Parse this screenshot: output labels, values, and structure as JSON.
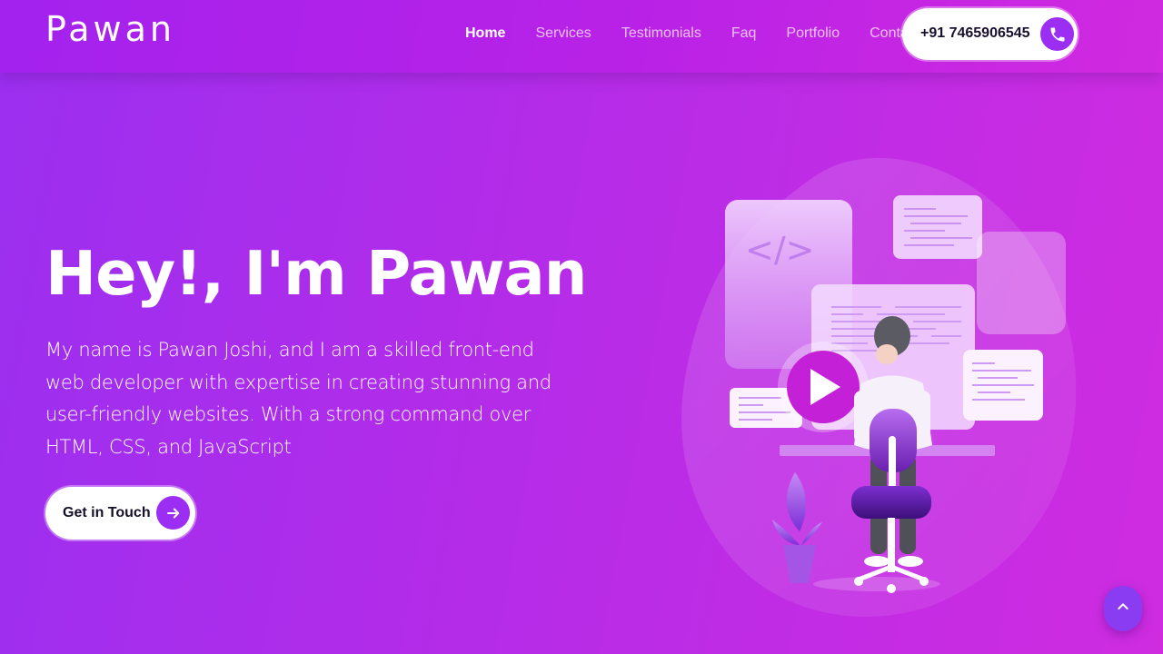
{
  "brand": {
    "logo": "Pawan"
  },
  "nav": {
    "links": [
      {
        "label": "Home",
        "active": true
      },
      {
        "label": "Services"
      },
      {
        "label": "Testimonials"
      },
      {
        "label": "Faq"
      },
      {
        "label": "Portfolio"
      },
      {
        "label": "Contact"
      }
    ],
    "phone": "+91 7465906545",
    "phone_icon": "phone-icon"
  },
  "hero": {
    "title": "Hey!, I'm Pawan",
    "description": "My name is Pawan Joshi, and I am a skilled front-end web developer with expertise in creating stunning and user-friendly websites. With a strong command over HTML, CSS, and JavaScript",
    "cta_label": "Get in Touch",
    "cta_icon": "arrow-right-icon"
  },
  "illustration": {
    "name": "developer-at-desk-illustration",
    "code_symbol": "</>"
  },
  "scroll_top_icon": "chevron-up-icon",
  "colors": {
    "background": "#b42ce8",
    "accent": "#9b2ef2",
    "text": "#ffffff"
  }
}
